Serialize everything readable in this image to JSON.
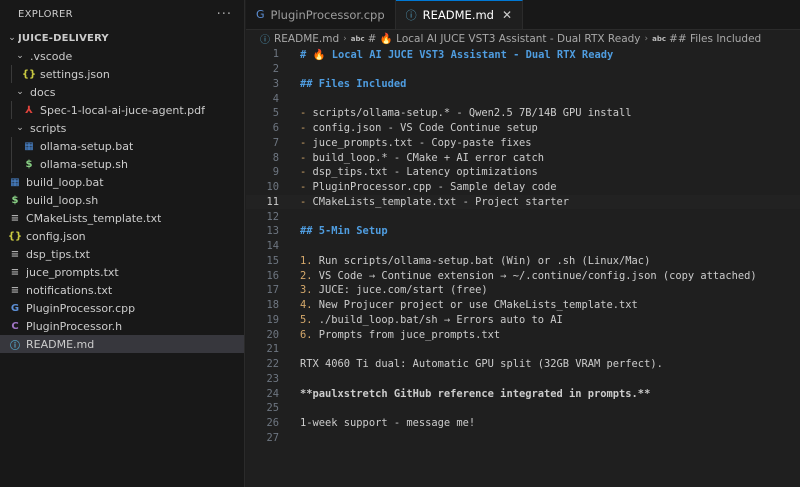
{
  "explorer": {
    "title": "EXPLORER",
    "more": "···",
    "root": "JUICE-DELIVERY",
    "items": [
      {
        "label": ".vscode",
        "kind": "folder",
        "depth": 1
      },
      {
        "label": "settings.json",
        "kind": "json",
        "depth": 2
      },
      {
        "label": "docs",
        "kind": "folder",
        "depth": 1
      },
      {
        "label": "Spec-1-local-ai-juce-agent.pdf",
        "kind": "pdf",
        "depth": 2
      },
      {
        "label": "scripts",
        "kind": "folder",
        "depth": 1
      },
      {
        "label": "ollama-setup.bat",
        "kind": "bat",
        "depth": 2
      },
      {
        "label": "ollama-setup.sh",
        "kind": "sh",
        "depth": 2
      },
      {
        "label": "build_loop.bat",
        "kind": "bat",
        "depth": 1
      },
      {
        "label": "build_loop.sh",
        "kind": "sh",
        "depth": 1
      },
      {
        "label": "CMakeLists_template.txt",
        "kind": "txt",
        "depth": 1
      },
      {
        "label": "config.json",
        "kind": "json",
        "depth": 1
      },
      {
        "label": "dsp_tips.txt",
        "kind": "txt",
        "depth": 1
      },
      {
        "label": "juce_prompts.txt",
        "kind": "txt",
        "depth": 1
      },
      {
        "label": "notifications.txt",
        "kind": "txt",
        "depth": 1
      },
      {
        "label": "PluginProcessor.cpp",
        "kind": "cpp",
        "depth": 1
      },
      {
        "label": "PluginProcessor.h",
        "kind": "h",
        "depth": 1
      },
      {
        "label": "README.md",
        "kind": "md",
        "depth": 1,
        "selected": true
      }
    ]
  },
  "tabs": [
    {
      "label": "PluginProcessor.cpp",
      "icon": "cpp-file-icon",
      "active": false
    },
    {
      "label": "README.md",
      "icon": "markdown-file-icon",
      "active": true,
      "close": "✕"
    }
  ],
  "breadcrumb": {
    "file": "README.md",
    "h1": "# 🔥 Local AI JUCE VST3 Assistant - Dual RTX Ready",
    "h2": "## Files Included",
    "abc": "abc"
  },
  "editor": {
    "current_line": 11,
    "lines": [
      {
        "n": "1",
        "text": "# 🔥 Local AI JUCE VST3 Assistant - Dual RTX Ready",
        "style": "heading"
      },
      {
        "n": "2",
        "text": "",
        "style": "txt"
      },
      {
        "n": "3",
        "text": "## Files Included",
        "style": "heading"
      },
      {
        "n": "4",
        "text": "",
        "style": "txt"
      },
      {
        "n": "5",
        "marker": "-",
        "text": " scripts/ollama-setup.* - Qwen2.5 7B/14B GPU install",
        "style": "bullet"
      },
      {
        "n": "6",
        "marker": "-",
        "text": " config.json - VS Code Continue setup",
        "style": "bullet"
      },
      {
        "n": "7",
        "marker": "-",
        "text": " juce_prompts.txt - Copy-paste fixes",
        "style": "bullet"
      },
      {
        "n": "8",
        "marker": "-",
        "text": " build_loop.* - CMake + AI error catch",
        "style": "bullet"
      },
      {
        "n": "9",
        "marker": "-",
        "text": " dsp_tips.txt - Latency optimizations",
        "style": "bullet"
      },
      {
        "n": "10",
        "marker": "-",
        "text": " PluginProcessor.cpp - Sample delay code",
        "style": "bullet"
      },
      {
        "n": "11",
        "marker": "-",
        "text": " CMakeLists_template.txt - Project starter",
        "style": "bullet"
      },
      {
        "n": "12",
        "text": "",
        "style": "txt"
      },
      {
        "n": "13",
        "text": "## 5-Min Setup",
        "style": "heading"
      },
      {
        "n": "14",
        "text": "",
        "style": "txt"
      },
      {
        "n": "15",
        "marker": "1.",
        "text": " Run scripts/ollama-setup.bat (Win) or .sh (Linux/Mac)",
        "style": "numl"
      },
      {
        "n": "16",
        "marker": "2.",
        "text": " VS Code → Continue extension → ~/.continue/config.json (copy attached)",
        "style": "numl"
      },
      {
        "n": "17",
        "marker": "3.",
        "text": " JUCE: juce.com/start (free)",
        "style": "numl"
      },
      {
        "n": "18",
        "marker": "4.",
        "text": " New Projucer project or use CMakeLists_template.txt",
        "style": "numl"
      },
      {
        "n": "19",
        "marker": "5.",
        "text": " ./build_loop.bat/sh → Errors auto to AI",
        "style": "numl"
      },
      {
        "n": "20",
        "marker": "6.",
        "text": " Prompts from juce_prompts.txt",
        "style": "numl"
      },
      {
        "n": "21",
        "text": "",
        "style": "txt"
      },
      {
        "n": "22",
        "text": "RTX 4060 Ti dual: Automatic GPU split (32GB VRAM perfect).",
        "style": "txt"
      },
      {
        "n": "23",
        "text": "",
        "style": "txt"
      },
      {
        "n": "24",
        "text": "**paulxstretch GitHub reference integrated in prompts.**",
        "style": "bold"
      },
      {
        "n": "25",
        "text": "",
        "style": "txt"
      },
      {
        "n": "26",
        "text": "1-week support - message me!",
        "style": "txt"
      },
      {
        "n": "27",
        "text": "",
        "style": "txt"
      }
    ]
  },
  "colors": {
    "accent": "#0078d4",
    "heading": "#4f9de0",
    "list_marker": "#d4a86b",
    "json_icon": "#cbcb41",
    "pdf_icon": "#e0443d",
    "bat_icon": "#4d8ddb",
    "sh_icon": "#89d185",
    "cpp_icon": "#5c8fd6",
    "h_icon": "#a074c4",
    "md_icon": "#519aba"
  }
}
